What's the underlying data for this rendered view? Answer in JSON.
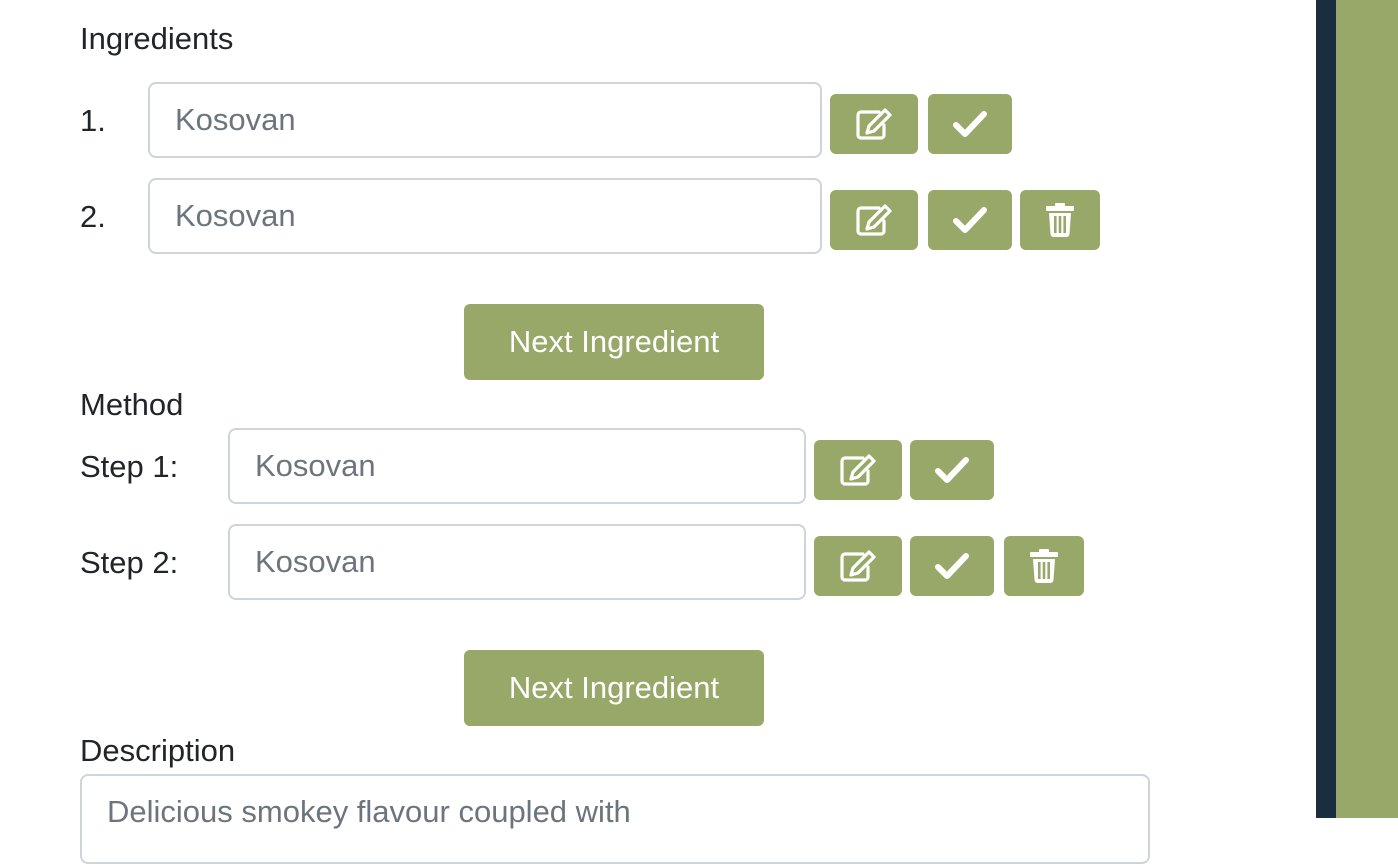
{
  "ingredients": {
    "heading": "Ingredients",
    "items": [
      {
        "number": "1.",
        "value": "Kosovan"
      },
      {
        "number": "2.",
        "value": "Kosovan"
      }
    ],
    "next_button": "Next Ingredient"
  },
  "method": {
    "heading": "Method",
    "steps": [
      {
        "label": "Step 1:",
        "value": "Kosovan"
      },
      {
        "label": "Step 2:",
        "value": "Kosovan"
      }
    ],
    "next_button": "Next Ingredient"
  },
  "description": {
    "heading": "Description",
    "value": "Delicious smokey flavour coupled with"
  },
  "icons": {
    "edit": "edit-icon",
    "confirm": "check-icon",
    "delete": "trash-icon"
  },
  "colors": {
    "accent": "#98a869",
    "sidebar_dark": "#1b2e40",
    "text": "#212529",
    "placeholder": "#6c757d",
    "border": "#ced4da"
  }
}
